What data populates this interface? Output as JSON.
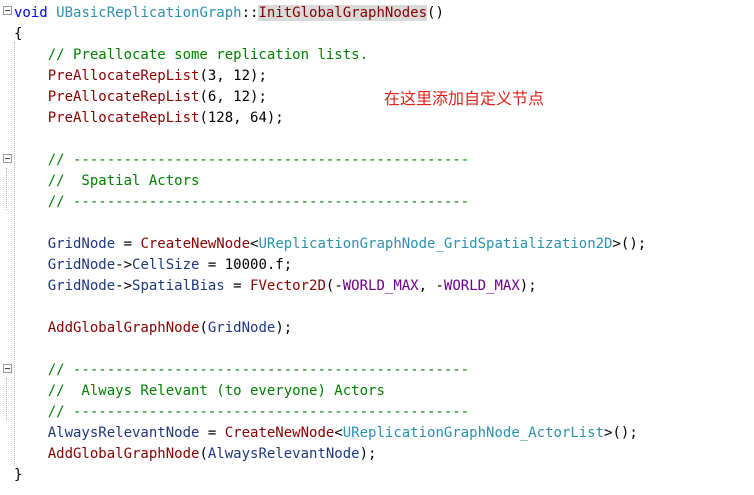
{
  "annotation": "在这里添加自定义节点",
  "tokens": {
    "kw_void": "void",
    "class_name": "UBasicReplicationGraph",
    "scope": "::",
    "method_name": "InitGlobalGraphNodes",
    "parens": "()",
    "open_brace": "{",
    "close_brace": "}",
    "c_prealloc": "// Preallocate some replication lists.",
    "f_prealloc": "PreAllocateRepList",
    "a_prealloc_1": "(3, 12);",
    "a_prealloc_2": "(6, 12);",
    "a_prealloc_3": "(128, 64);",
    "c_divider": "// -----------------------------------------------",
    "c_spatial": "//  Spatial Actors",
    "v_gridnode": "GridNode",
    "op_assign": " = ",
    "f_createnewnode": "CreateNewNode",
    "lt": "<",
    "t_grid": "UReplicationGraphNode_GridSpatialization2D",
    "gt_call_end": ">();",
    "arrow": "->",
    "m_cellsize": "CellSize",
    "v_cellsize_rest": " = 10000.f;",
    "m_spatialbias": "SpatialBias",
    "t_fvector2d": "FVector2D",
    "paren_minus": "(-",
    "mac_world_max": "WORLD_MAX",
    "comma_minus": ", -",
    "close_paren_semi": ");",
    "f_addglobal": "AddGlobalGraphNode",
    "open_paren": "(",
    "c_always": "//  Always Relevant (to everyone) Actors",
    "v_alwaysrelevant": "AlwaysRelevantNode",
    "t_actorlist": "UReplicationGraphNode_ActorList"
  },
  "colors": {
    "keyword": "#0000ff",
    "type": "#2b91af",
    "function": "#880000",
    "comment": "#008000",
    "variable": "#1f377f",
    "macro": "#6f008a",
    "annotation": "#e0211c",
    "highlight": "#dadada"
  }
}
